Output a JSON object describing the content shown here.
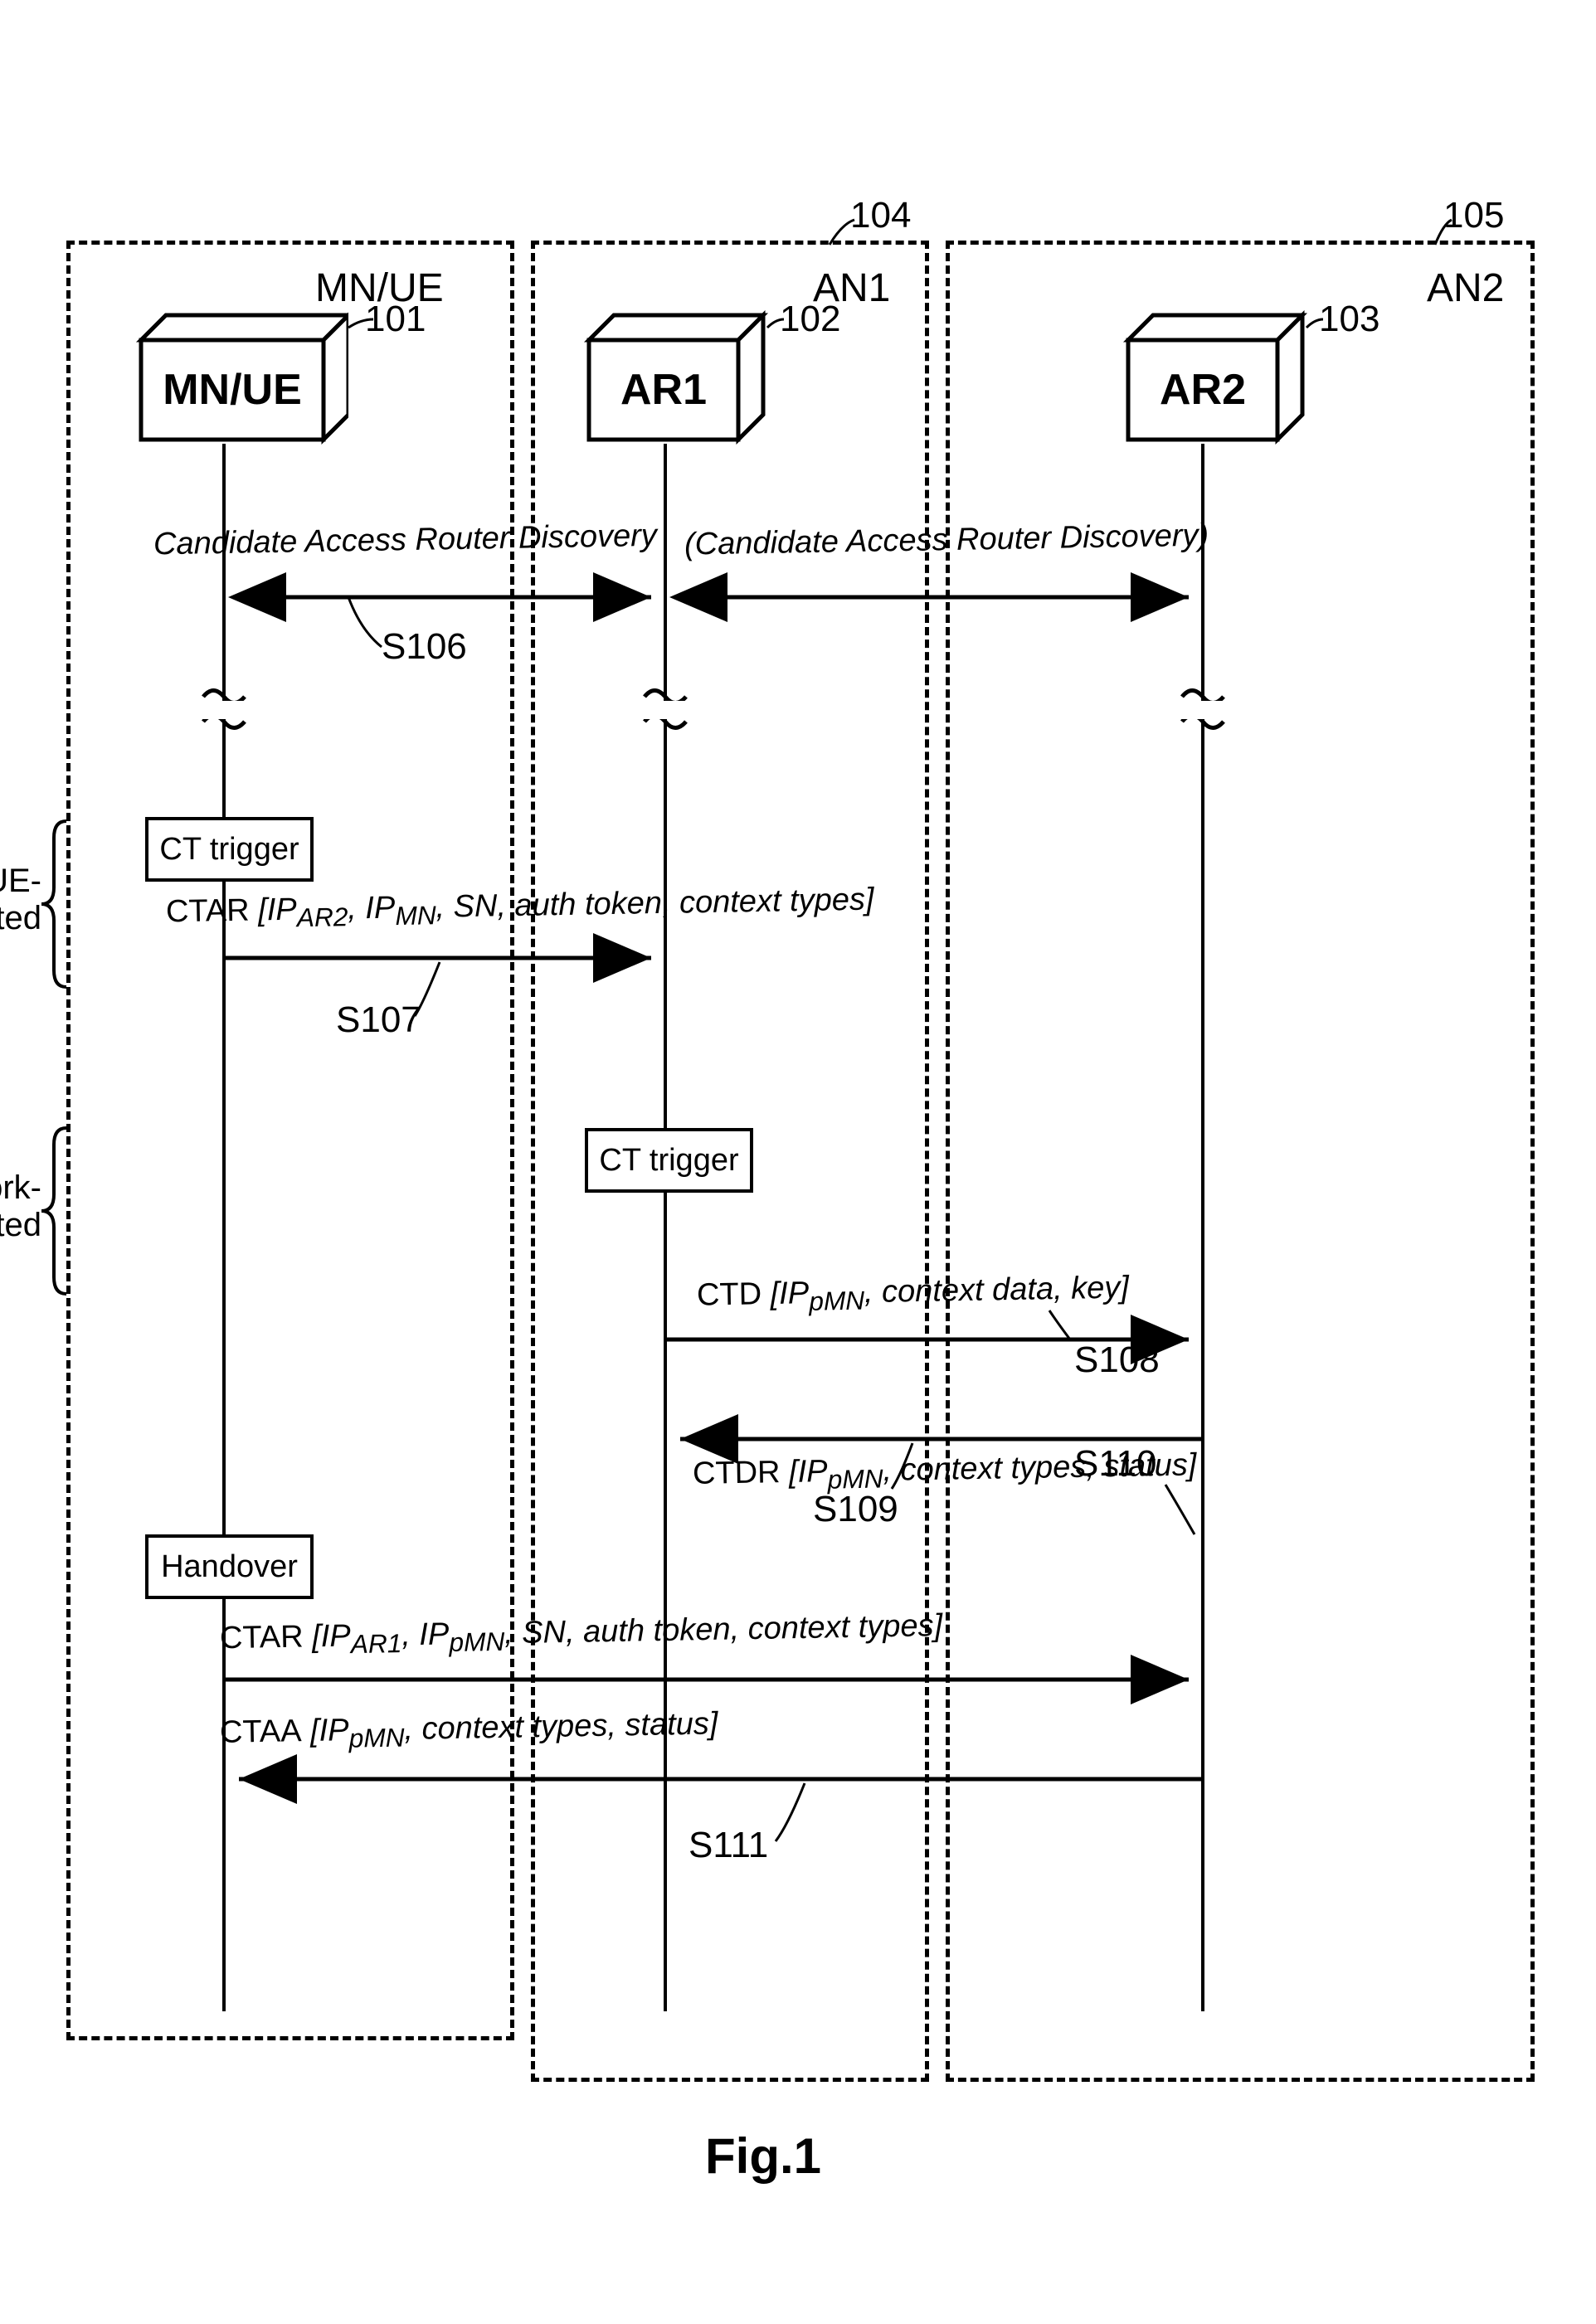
{
  "nodes": {
    "mn_ue": {
      "label": "MN/UE",
      "ref": "101"
    },
    "ar1": {
      "label": "AR1",
      "ref": "102"
    },
    "ar2": {
      "label": "AR2",
      "ref": "103"
    }
  },
  "areas": {
    "mn_ue_area": {
      "label": "MN/UE"
    },
    "an1": {
      "label": "AN1",
      "ref": "104"
    },
    "an2": {
      "label": "AN2",
      "ref": "105"
    }
  },
  "messages": {
    "card_left": "Candidate Access Router Discovery",
    "card_right": "(Candidate Access Router Discovery)",
    "ctar1": "CTAR [IP_AR2, IP_MN, SN, auth token, context types]",
    "ctd": "CTD [IP_pMN, context data, key]",
    "ctdr": "CTDR [IP_pMN, context types, status]",
    "ctar2": "CTAR [IP_AR1, IP_pMN, SN, auth token, context types]",
    "ctaa": "CTAA [IP_pMN, context types, status]"
  },
  "steps": {
    "s106": "S106",
    "s107": "S107",
    "s108": "S108",
    "s109": "S109",
    "s110": "S110",
    "s111": "S111"
  },
  "boxes": {
    "ct_trigger_ue": "CT trigger",
    "ct_trigger_nw": "CT trigger",
    "handover": "Handover"
  },
  "side": {
    "ue_init": "UE-\ninitiated",
    "nw_init": "Network-\ninitiated"
  },
  "figure": "Fig.1"
}
